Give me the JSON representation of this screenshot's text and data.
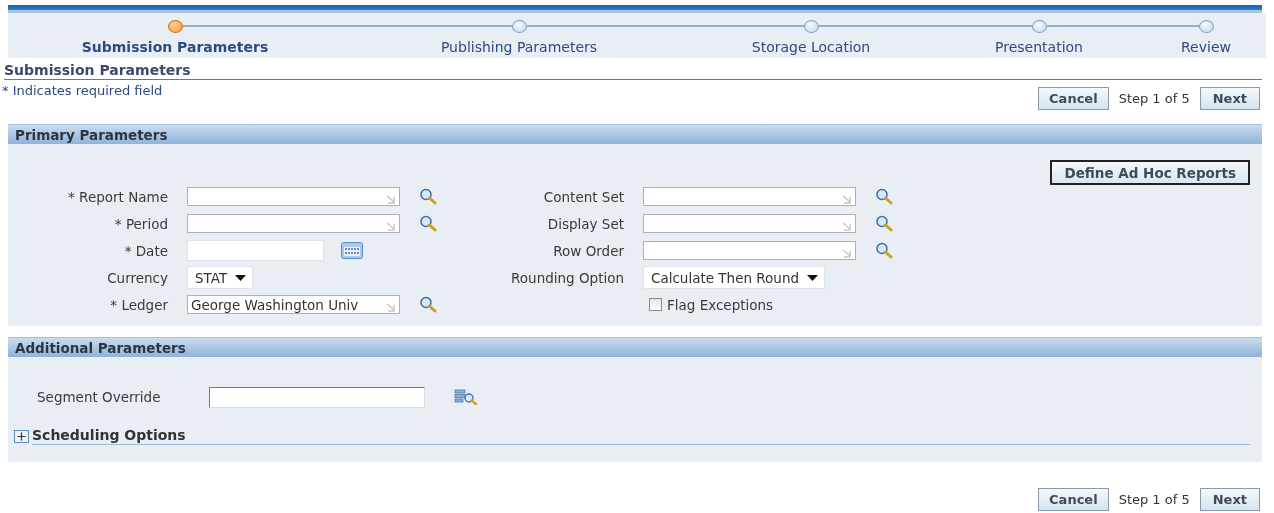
{
  "train": {
    "steps": [
      {
        "label": "Submission Parameters",
        "selected": true
      },
      {
        "label": "Publishing Parameters",
        "selected": false
      },
      {
        "label": "Storage Location",
        "selected": false
      },
      {
        "label": "Presentation",
        "selected": false
      },
      {
        "label": "Review",
        "selected": false
      }
    ]
  },
  "page_title": "Submission Parameters",
  "required_note": "* Indicates required field",
  "nav_top": {
    "cancel": "Cancel",
    "step": "Step 1 of 5",
    "next": "Next"
  },
  "primary": {
    "title": "Primary Parameters",
    "action": "Define Ad Hoc Reports",
    "left_fields": [
      {
        "label": "* Report Name",
        "kind": "lov"
      },
      {
        "label": "* Period",
        "kind": "lov"
      },
      {
        "label": "* Date",
        "kind": "date"
      },
      {
        "label": "Currency",
        "kind": "select",
        "value": "STAT"
      },
      {
        "label": "* Ledger",
        "kind": "lov",
        "value": "George Washington Univ"
      }
    ],
    "right_fields": [
      {
        "label": "Content Set",
        "kind": "lov"
      },
      {
        "label": "Display Set",
        "kind": "lov"
      },
      {
        "label": "Row Order",
        "kind": "lov"
      },
      {
        "label": "Rounding Option",
        "kind": "select",
        "value": "Calculate Then Round"
      },
      {
        "label": "Flag Exceptions",
        "kind": "checkbox",
        "checked": false
      }
    ]
  },
  "additional": {
    "title": "Additional Parameters",
    "fields": [
      {
        "label": "Segment Override",
        "kind": "flex"
      }
    ],
    "sections": [
      {
        "label": "Scheduling Options",
        "expanded": false
      }
    ]
  },
  "nav_bottom": {
    "cancel": "Cancel",
    "step": "Step 1 of 5",
    "next": "Next"
  }
}
